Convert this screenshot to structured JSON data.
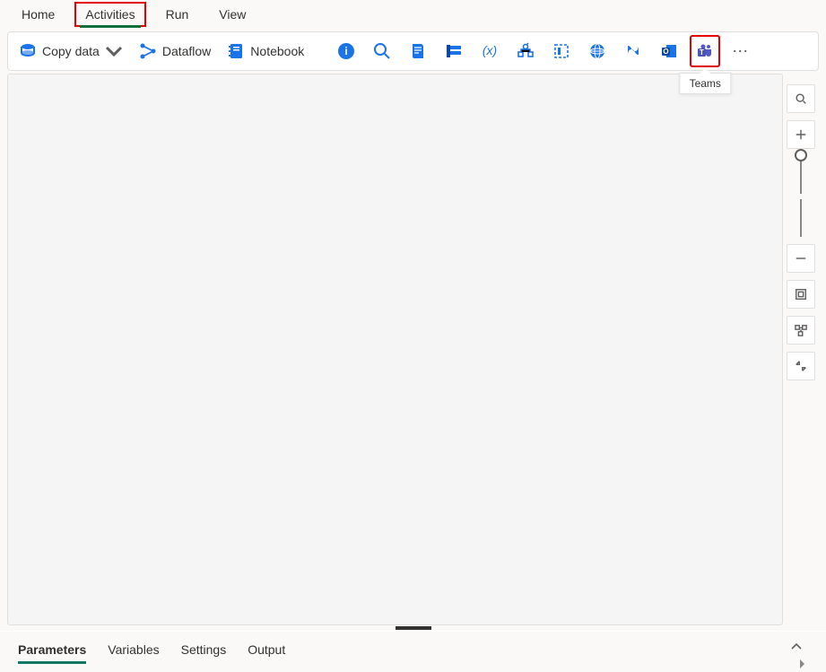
{
  "menu": {
    "items": [
      "Home",
      "Activities",
      "Run",
      "View"
    ],
    "selected": "Activities"
  },
  "toolbar": {
    "copy_data": {
      "label": "Copy data"
    },
    "dataflow": {
      "label": "Dataflow"
    },
    "notebook": {
      "label": "Notebook"
    },
    "icons": [
      "info-icon",
      "search-icon",
      "script-icon",
      "form-icon",
      "variable-icon",
      "pipeline-icon",
      "template-icon",
      "web-icon",
      "powerplatform-icon",
      "outlook-icon",
      "teams-icon"
    ],
    "highlighted": "teams-icon",
    "tooltip": "Teams",
    "more": "⋯"
  },
  "canvas_controls": [
    "search-icon",
    "zoom-in-icon",
    "zoom-slider",
    "zoom-out-icon",
    "fit-to-screen-icon",
    "auto-align-icon",
    "minimize-icon"
  ],
  "footer": {
    "tabs": [
      "Parameters",
      "Variables",
      "Settings",
      "Output"
    ],
    "selected": "Parameters"
  }
}
